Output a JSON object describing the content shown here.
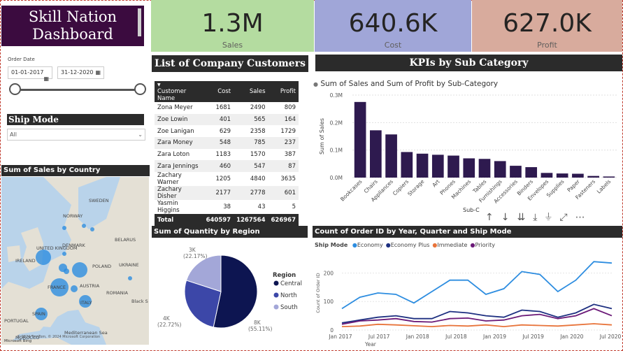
{
  "dashboard": {
    "title_line1": "Skill Nation",
    "title_line2": "Dashboard"
  },
  "kpis": [
    {
      "value": "1.3M",
      "label": "Sales",
      "color": "#b4dca0"
    },
    {
      "value": "640.6K",
      "label": "Cost",
      "color": "#a0a6d8"
    },
    {
      "value": "627.0K",
      "label": "Profit",
      "color": "#d8ab9d"
    }
  ],
  "slicer": {
    "label": "Order Date",
    "start": "01-01-2017",
    "end": "31-12-2020",
    "ship_mode_title": "Ship Mode",
    "ship_mode_value": "All"
  },
  "customers": {
    "title": "List of Company Customers",
    "columns": [
      "Customer Name",
      "Cost",
      "Sales",
      "Profit"
    ],
    "rows": [
      [
        "Zona Meyer",
        "1681",
        "2490",
        "809"
      ],
      [
        "Zoe Lowin",
        "401",
        "565",
        "164"
      ],
      [
        "Zoe Lanigan",
        "629",
        "2358",
        "1729"
      ],
      [
        "Zara Money",
        "548",
        "785",
        "237"
      ],
      [
        "Zara Loton",
        "1183",
        "1570",
        "387"
      ],
      [
        "Zara Jennings",
        "460",
        "547",
        "87"
      ],
      [
        "Zachary Warner",
        "1205",
        "4840",
        "3635"
      ],
      [
        "Zachary Disher",
        "2177",
        "2778",
        "601"
      ],
      [
        "Yasmin Higgins",
        "38",
        "43",
        "5"
      ]
    ],
    "total": [
      "Total",
      "640597",
      "1267564",
      "626967"
    ]
  },
  "map": {
    "title": "Sum of Sales by Country",
    "labels": [
      "SWEDEN",
      "NORWAY",
      "DENMARK",
      "UNITED KINGDOM",
      "IRELAND",
      "BELARUS",
      "POLAND",
      "UKRAINE",
      "FRANCE",
      "AUSTRIA",
      "ROMANIA",
      "ITALY",
      "SPAIN",
      "PORTUGAL",
      "MOROCCO",
      "Black S",
      "Mediterranean Sea"
    ],
    "copyright": "© 2024 TomTom, © 2024 Microsoft Corporation",
    "brand": "Microsoft Bing"
  },
  "kpi_subcat": {
    "title": "KPIs by Sub Category"
  },
  "chart_subcat": {
    "title": "Sum of Sales and Sum of Profit by Sub-Category",
    "toolbar_label": "Sub-C",
    "chart_data": {
      "type": "bar",
      "categories": [
        "Bookcases",
        "Chairs",
        "Appliances",
        "Copiers",
        "Storage",
        "Art",
        "Phones",
        "Machines",
        "Tables",
        "Furnishings",
        "Accessories",
        "Binders",
        "Envelopes",
        "Supplies",
        "Paper",
        "Fasteners",
        "Labels"
      ],
      "values": [
        275000,
        172000,
        157000,
        93000,
        87000,
        83000,
        80000,
        70000,
        68000,
        60000,
        43000,
        38000,
        17000,
        15000,
        14000,
        6000,
        4000
      ],
      "ylabel": "Sum of Sales",
      "ylim": [
        0,
        300000
      ],
      "yticks": [
        "0.0M",
        "0.1M",
        "0.2M",
        "0.3M"
      ],
      "color": "#2e1a4f"
    }
  },
  "chart_region": {
    "title": "Sum of Quantity by Region",
    "chart_data": {
      "type": "pie",
      "legend_title": "Region",
      "slices": [
        {
          "name": "Central",
          "value": 8000,
          "label": "8K",
          "pct": "(55.11%)",
          "color": "#0d1551"
        },
        {
          "name": "North",
          "value": 4000,
          "label": "4K",
          "pct": "(22.72%)",
          "color": "#3c47a8"
        },
        {
          "name": "South",
          "value": 3000,
          "label": "3K",
          "pct": "(22.17%)",
          "color": "#a3a7d8"
        }
      ]
    }
  },
  "chart_orders": {
    "title": "Count of Order ID by Year, Quarter and Ship Mode",
    "legend_title": "Ship Mode",
    "xlabel": "Year",
    "ylabel": "Count of Order ID",
    "chart_data": {
      "type": "line",
      "x": [
        "Jan 2017",
        "",
        "",
        "",
        "Jan 2018",
        "",
        "",
        "",
        "Jul 2018",
        "",
        "",
        "",
        "Jan 2019",
        "",
        "",
        "Jul 2019",
        "",
        "",
        "Jan 2020",
        "",
        "",
        "Jul 2020",
        "",
        ""
      ],
      "xticks": [
        "Jan 2017",
        "Jul 2017",
        "Jan 2018",
        "Jul 2018",
        "Jan 2019",
        "Jul 2019",
        "Jan 2020",
        "Jul 2020"
      ],
      "yticks": [
        "0",
        "100",
        "200"
      ],
      "ylim": [
        0,
        260
      ],
      "series": [
        {
          "name": "Economy",
          "color": "#2d8de0",
          "values": [
            75,
            115,
            130,
            125,
            95,
            135,
            175,
            175,
            125,
            145,
            205,
            195,
            135,
            175,
            240,
            235
          ]
        },
        {
          "name": "Economy Plus",
          "color": "#1d2f80",
          "values": [
            25,
            35,
            45,
            50,
            40,
            40,
            65,
            60,
            50,
            45,
            70,
            65,
            45,
            60,
            90,
            75
          ]
        },
        {
          "name": "Immediate",
          "color": "#e8743b",
          "values": [
            12,
            14,
            20,
            18,
            15,
            12,
            16,
            14,
            18,
            12,
            18,
            16,
            14,
            18,
            22,
            18
          ]
        },
        {
          "name": "Priority",
          "color": "#6b1a78",
          "values": [
            20,
            32,
            35,
            40,
            30,
            28,
            40,
            42,
            32,
            35,
            50,
            55,
            40,
            50,
            75,
            50
          ]
        }
      ]
    }
  }
}
